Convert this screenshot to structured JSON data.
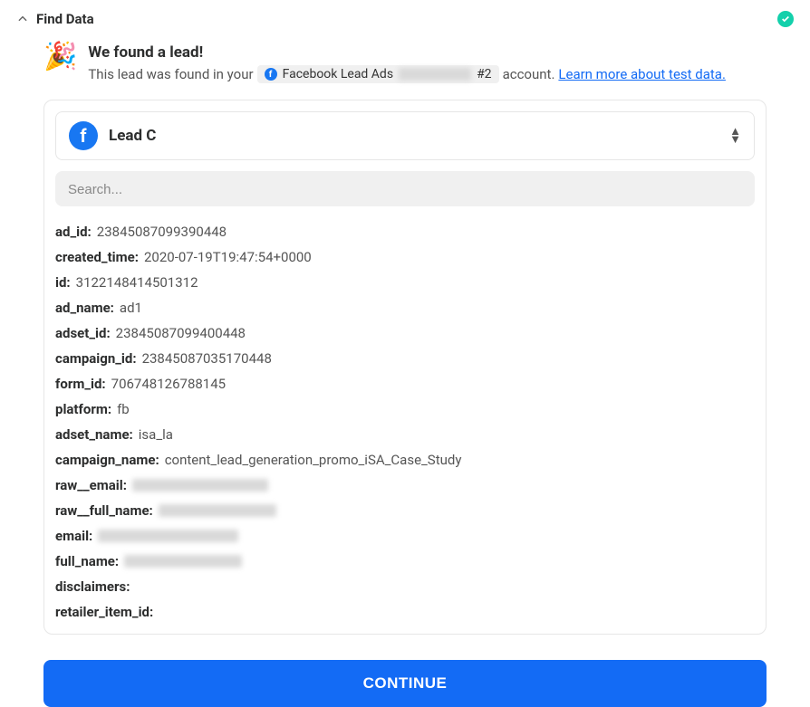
{
  "header": {
    "title": "Find Data"
  },
  "intro": {
    "emoji": "🎉",
    "title": "We found a lead!",
    "prefix": "This lead was found in your",
    "account_name_prefix": "Facebook Lead Ads",
    "account_suffix": "#2",
    "after": "account.",
    "learn_link": "Learn more about test data."
  },
  "lead_select": {
    "label": "Lead C"
  },
  "search": {
    "placeholder": "Search..."
  },
  "fields": [
    {
      "key": "ad_id:",
      "value": "23845087099390448",
      "blurred": false
    },
    {
      "key": "created_time:",
      "value": "2020-07-19T19:47:54+0000",
      "blurred": false
    },
    {
      "key": "id:",
      "value": "3122148414501312",
      "blurred": false
    },
    {
      "key": "ad_name:",
      "value": "ad1",
      "blurred": false
    },
    {
      "key": "adset_id:",
      "value": "23845087099400448",
      "blurred": false
    },
    {
      "key": "campaign_id:",
      "value": "23845087035170448",
      "blurred": false
    },
    {
      "key": "form_id:",
      "value": "706748126788145",
      "blurred": false
    },
    {
      "key": "platform:",
      "value": "fb",
      "blurred": false
    },
    {
      "key": "adset_name:",
      "value": "isa_la",
      "blurred": false
    },
    {
      "key": "campaign_name:",
      "value": "content_lead_generation_promo_iSA_Case_Study",
      "blurred": false
    },
    {
      "key": "raw__email:",
      "value": "",
      "blurred": true,
      "blur_width": 150
    },
    {
      "key": "raw__full_name:",
      "value": "",
      "blurred": true,
      "blur_width": 130
    },
    {
      "key": "email:",
      "value": "",
      "blurred": true,
      "blur_width": 155
    },
    {
      "key": "full_name:",
      "value": "",
      "blurred": true,
      "blur_width": 130
    },
    {
      "key": "disclaimers:",
      "value": "",
      "blurred": false
    },
    {
      "key": "retailer_item_id:",
      "value": "",
      "blurred": false
    }
  ],
  "continue_label": "CONTINUE"
}
